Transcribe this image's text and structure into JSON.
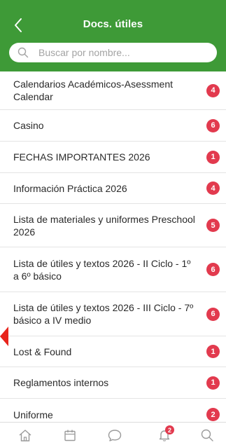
{
  "header": {
    "title": "Docs. útiles",
    "back_icon": "chevron-left-icon",
    "background": "#3e9a37"
  },
  "search": {
    "placeholder": "Buscar por nombre...",
    "value": "",
    "icon": "search-icon"
  },
  "documents": [
    {
      "label": "Calendarios Académicos-Asessment Calendar",
      "count": "4"
    },
    {
      "label": "Casino",
      "count": "6"
    },
    {
      "label": "FECHAS IMPORTANTES 2026",
      "count": "1"
    },
    {
      "label": "Información Práctica 2026",
      "count": "4"
    },
    {
      "label": "Lista de materiales y uniformes Preschool 2026",
      "count": "5"
    },
    {
      "label": "Lista de útiles y textos 2026 - II Ciclo - 1º a 6º básico",
      "count": "6"
    },
    {
      "label": "Lista de útiles y textos 2026 - III Ciclo - 7º básico a IV medio",
      "count": "6"
    },
    {
      "label": "Lost & Found",
      "count": "1"
    },
    {
      "label": "Reglamentos internos",
      "count": "1"
    },
    {
      "label": "Uniforme",
      "count": "2"
    }
  ],
  "tabbar": {
    "tabs": [
      {
        "icon": "home-icon"
      },
      {
        "icon": "calendar-icon"
      },
      {
        "icon": "chat-icon"
      },
      {
        "icon": "bell-icon",
        "badge": "2"
      },
      {
        "icon": "search-icon"
      }
    ]
  },
  "colors": {
    "badge": "#e23a4e",
    "marker": "#e8241c"
  }
}
